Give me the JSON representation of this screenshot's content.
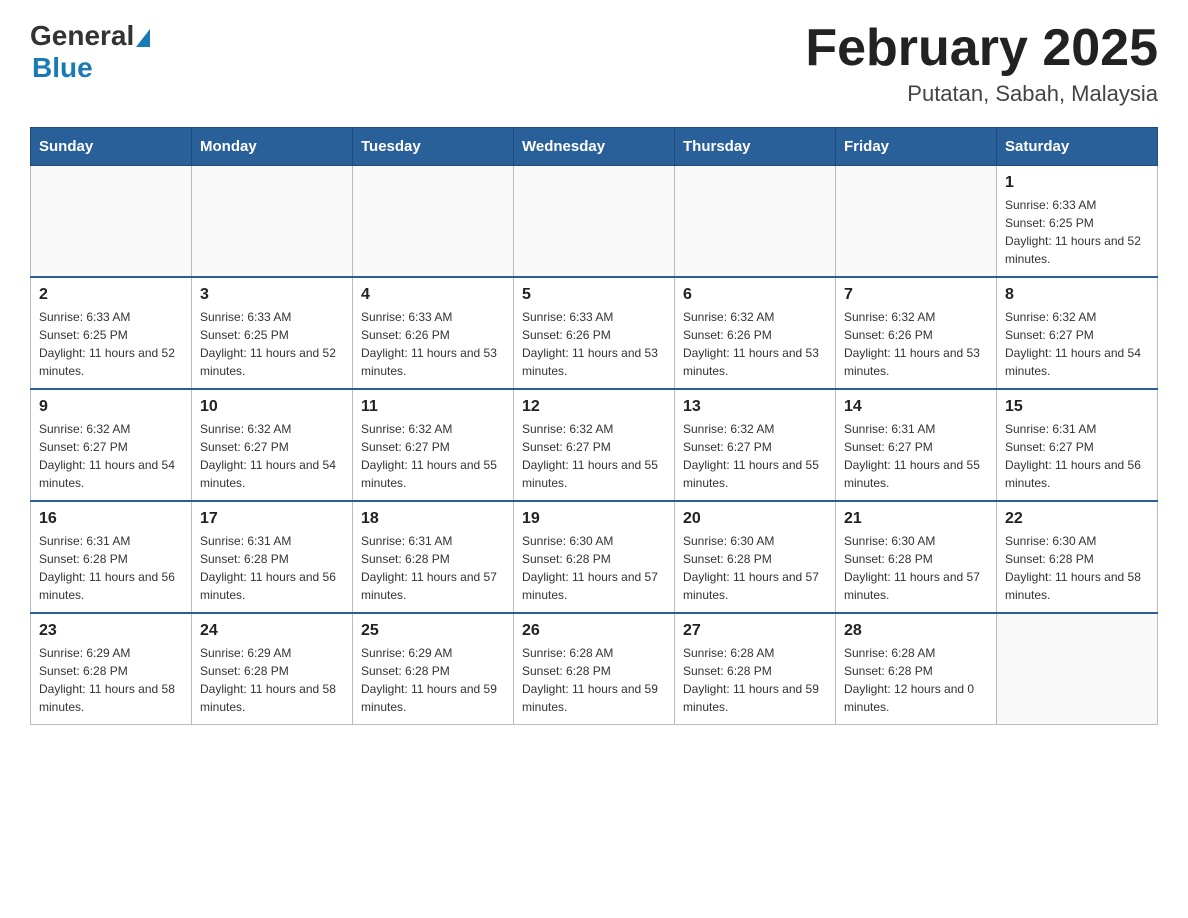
{
  "header": {
    "logo_general": "General",
    "logo_blue": "Blue",
    "month_title": "February 2025",
    "location": "Putatan, Sabah, Malaysia"
  },
  "days_of_week": [
    "Sunday",
    "Monday",
    "Tuesday",
    "Wednesday",
    "Thursday",
    "Friday",
    "Saturday"
  ],
  "weeks": [
    [
      {
        "day": "",
        "info": ""
      },
      {
        "day": "",
        "info": ""
      },
      {
        "day": "",
        "info": ""
      },
      {
        "day": "",
        "info": ""
      },
      {
        "day": "",
        "info": ""
      },
      {
        "day": "",
        "info": ""
      },
      {
        "day": "1",
        "info": "Sunrise: 6:33 AM\nSunset: 6:25 PM\nDaylight: 11 hours and 52 minutes."
      }
    ],
    [
      {
        "day": "2",
        "info": "Sunrise: 6:33 AM\nSunset: 6:25 PM\nDaylight: 11 hours and 52 minutes."
      },
      {
        "day": "3",
        "info": "Sunrise: 6:33 AM\nSunset: 6:25 PM\nDaylight: 11 hours and 52 minutes."
      },
      {
        "day": "4",
        "info": "Sunrise: 6:33 AM\nSunset: 6:26 PM\nDaylight: 11 hours and 53 minutes."
      },
      {
        "day": "5",
        "info": "Sunrise: 6:33 AM\nSunset: 6:26 PM\nDaylight: 11 hours and 53 minutes."
      },
      {
        "day": "6",
        "info": "Sunrise: 6:32 AM\nSunset: 6:26 PM\nDaylight: 11 hours and 53 minutes."
      },
      {
        "day": "7",
        "info": "Sunrise: 6:32 AM\nSunset: 6:26 PM\nDaylight: 11 hours and 53 minutes."
      },
      {
        "day": "8",
        "info": "Sunrise: 6:32 AM\nSunset: 6:27 PM\nDaylight: 11 hours and 54 minutes."
      }
    ],
    [
      {
        "day": "9",
        "info": "Sunrise: 6:32 AM\nSunset: 6:27 PM\nDaylight: 11 hours and 54 minutes."
      },
      {
        "day": "10",
        "info": "Sunrise: 6:32 AM\nSunset: 6:27 PM\nDaylight: 11 hours and 54 minutes."
      },
      {
        "day": "11",
        "info": "Sunrise: 6:32 AM\nSunset: 6:27 PM\nDaylight: 11 hours and 55 minutes."
      },
      {
        "day": "12",
        "info": "Sunrise: 6:32 AM\nSunset: 6:27 PM\nDaylight: 11 hours and 55 minutes."
      },
      {
        "day": "13",
        "info": "Sunrise: 6:32 AM\nSunset: 6:27 PM\nDaylight: 11 hours and 55 minutes."
      },
      {
        "day": "14",
        "info": "Sunrise: 6:31 AM\nSunset: 6:27 PM\nDaylight: 11 hours and 55 minutes."
      },
      {
        "day": "15",
        "info": "Sunrise: 6:31 AM\nSunset: 6:27 PM\nDaylight: 11 hours and 56 minutes."
      }
    ],
    [
      {
        "day": "16",
        "info": "Sunrise: 6:31 AM\nSunset: 6:28 PM\nDaylight: 11 hours and 56 minutes."
      },
      {
        "day": "17",
        "info": "Sunrise: 6:31 AM\nSunset: 6:28 PM\nDaylight: 11 hours and 56 minutes."
      },
      {
        "day": "18",
        "info": "Sunrise: 6:31 AM\nSunset: 6:28 PM\nDaylight: 11 hours and 57 minutes."
      },
      {
        "day": "19",
        "info": "Sunrise: 6:30 AM\nSunset: 6:28 PM\nDaylight: 11 hours and 57 minutes."
      },
      {
        "day": "20",
        "info": "Sunrise: 6:30 AM\nSunset: 6:28 PM\nDaylight: 11 hours and 57 minutes."
      },
      {
        "day": "21",
        "info": "Sunrise: 6:30 AM\nSunset: 6:28 PM\nDaylight: 11 hours and 57 minutes."
      },
      {
        "day": "22",
        "info": "Sunrise: 6:30 AM\nSunset: 6:28 PM\nDaylight: 11 hours and 58 minutes."
      }
    ],
    [
      {
        "day": "23",
        "info": "Sunrise: 6:29 AM\nSunset: 6:28 PM\nDaylight: 11 hours and 58 minutes."
      },
      {
        "day": "24",
        "info": "Sunrise: 6:29 AM\nSunset: 6:28 PM\nDaylight: 11 hours and 58 minutes."
      },
      {
        "day": "25",
        "info": "Sunrise: 6:29 AM\nSunset: 6:28 PM\nDaylight: 11 hours and 59 minutes."
      },
      {
        "day": "26",
        "info": "Sunrise: 6:28 AM\nSunset: 6:28 PM\nDaylight: 11 hours and 59 minutes."
      },
      {
        "day": "27",
        "info": "Sunrise: 6:28 AM\nSunset: 6:28 PM\nDaylight: 11 hours and 59 minutes."
      },
      {
        "day": "28",
        "info": "Sunrise: 6:28 AM\nSunset: 6:28 PM\nDaylight: 12 hours and 0 minutes."
      },
      {
        "day": "",
        "info": ""
      }
    ]
  ]
}
